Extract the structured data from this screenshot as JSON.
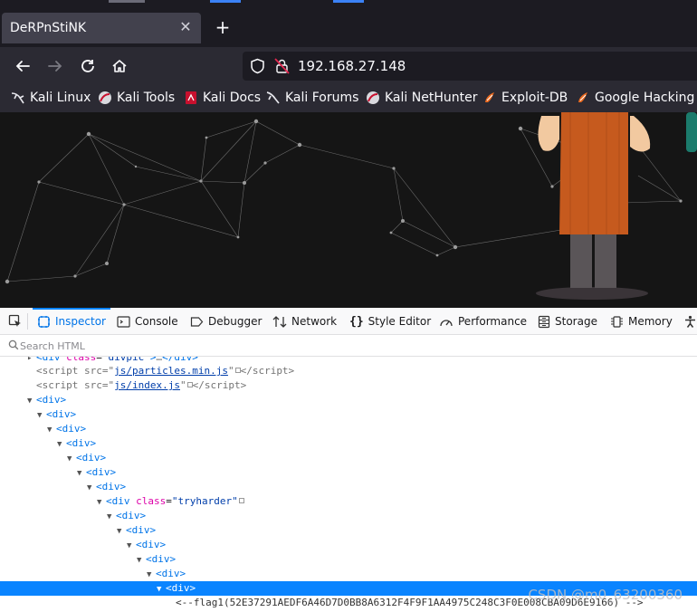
{
  "browser": {
    "tab_title": "DeRPnStiNK",
    "url": "192.168.27.148"
  },
  "bookmarks": [
    {
      "label": "Kali Linux",
      "icon": "kali-dragon-icon"
    },
    {
      "label": "Kali Tools",
      "icon": "kali-tools-icon"
    },
    {
      "label": "Kali Docs",
      "icon": "kali-docs-icon"
    },
    {
      "label": "Kali Forums",
      "icon": "kali-forums-icon"
    },
    {
      "label": "Kali NetHunter",
      "icon": "kali-nethunter-icon"
    },
    {
      "label": "Exploit-DB",
      "icon": "exploit-db-icon"
    },
    {
      "label": "Google Hacking DB",
      "icon": "ghdb-icon"
    }
  ],
  "devtools": {
    "tabs": [
      "Inspector",
      "Console",
      "Debugger",
      "Network",
      "Style Editor",
      "Performance",
      "Storage",
      "Memory"
    ],
    "search_placeholder": "Search HTML"
  },
  "markup": {
    "script1_src": "js/particles.min.js",
    "script2_src": "js/index.js",
    "tryharder_class": "tryharder",
    "flag_comment": "<--flag1(52E37291AEDF6A46D7D0BB8A6312F4F9F1AA4975C248C3F0E008CBA09D6E9166) -->"
  },
  "watermark": "CSDN @m0_63200360"
}
